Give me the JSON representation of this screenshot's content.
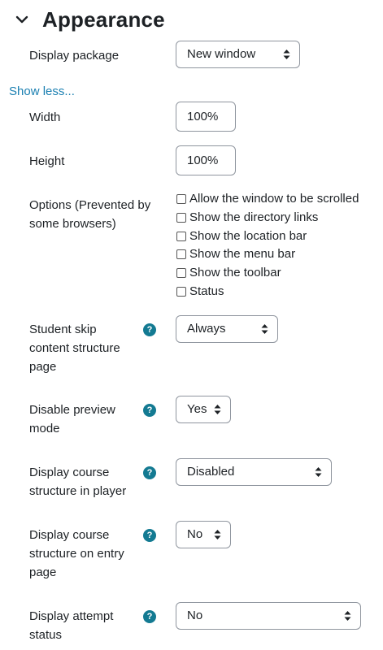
{
  "section": {
    "title": "Appearance"
  },
  "display_package": {
    "label": "Display package",
    "value": "New window"
  },
  "show_less": "Show less...",
  "width": {
    "label": "Width",
    "value": "100%"
  },
  "height": {
    "label": "Height",
    "value": "100%"
  },
  "options": {
    "label_line1": "Options (Prevented by",
    "label_line2": "some browsers)",
    "checkboxes": [
      "Allow the window to be scrolled",
      "Show the directory links",
      "Show the location bar",
      "Show the menu bar",
      "Show the toolbar",
      "Status"
    ]
  },
  "skip_content": {
    "label_line1": "Student skip",
    "label_line2": "content structure",
    "label_line3": "page",
    "value": "Always"
  },
  "disable_preview": {
    "label_line1": "Disable preview",
    "label_line2": "mode",
    "value": "Yes"
  },
  "course_structure_player": {
    "label_line1": "Display course",
    "label_line2": "structure in player",
    "value": "Disabled"
  },
  "course_structure_entry": {
    "label_line1": "Display course",
    "label_line2": "structure on entry",
    "label_line3": "page",
    "value": "No"
  },
  "attempt_status": {
    "label_line1": "Display attempt",
    "label_line2": "status",
    "value": "No"
  },
  "help_glyph": "?",
  "colors": {
    "link": "#1a7fb1",
    "help_icon": "#137a92",
    "border": "#8f959e"
  }
}
